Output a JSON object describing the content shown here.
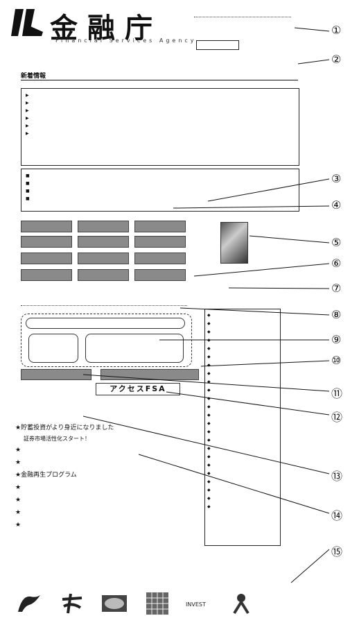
{
  "header": {
    "brand": "金融庁",
    "brand_sub": "Financial Services Agency",
    "top_date": "",
    "search_label": "",
    "search_button": "",
    "english_link": ""
  },
  "bar2_text": "",
  "news_line": "新着情報",
  "notice_box": {
    "title": "",
    "items": [
      "",
      "",
      "",
      "",
      "",
      ""
    ]
  },
  "pickup": {
    "title": "",
    "link": "",
    "items": [
      "",
      "",
      "",
      ""
    ]
  },
  "gray_buttons": [
    "",
    "",
    "",
    "",
    "",
    "",
    "",
    "",
    "",
    "",
    "",
    ""
  ],
  "photo_caption": "",
  "consult": {
    "title": "",
    "inner_top": "",
    "inner_left": "",
    "inner_right": ""
  },
  "bottom_buttons": [
    "",
    ""
  ],
  "access": {
    "label": "",
    "button": "アクセスFSA"
  },
  "side": {
    "title": "",
    "items": [
      "",
      "",
      "",
      "",
      "",
      "",
      "",
      "",
      "",
      "",
      "",
      "",
      "",
      "",
      "",
      "",
      "",
      "",
      "",
      "",
      "",
      "",
      "",
      ""
    ]
  },
  "topics_header": "",
  "topics": [
    {
      "text": "貯蓄投資がより身近になりました",
      "type": "main"
    },
    {
      "text": "証券市場活性化スタート！",
      "type": "sub"
    },
    {
      "text": "",
      "type": "main"
    },
    {
      "text": "",
      "type": "sub"
    },
    {
      "text": "",
      "type": "sub"
    },
    {
      "text": "",
      "type": "main"
    },
    {
      "text": "金融再生プログラム",
      "type": "main"
    },
    {
      "text": "",
      "type": "main"
    },
    {
      "text": "",
      "type": "main"
    },
    {
      "text": "",
      "type": "main"
    },
    {
      "text": "",
      "type": "main"
    }
  ],
  "footer_logos": [
    "",
    "",
    "",
    "",
    "",
    ""
  ],
  "callouts": [
    "①",
    "②",
    "③",
    "④",
    "⑤",
    "⑥",
    "⑦",
    "⑧",
    "⑨",
    "⑩",
    "⑪",
    "⑫",
    "⑬",
    "⑭",
    "⑮"
  ]
}
